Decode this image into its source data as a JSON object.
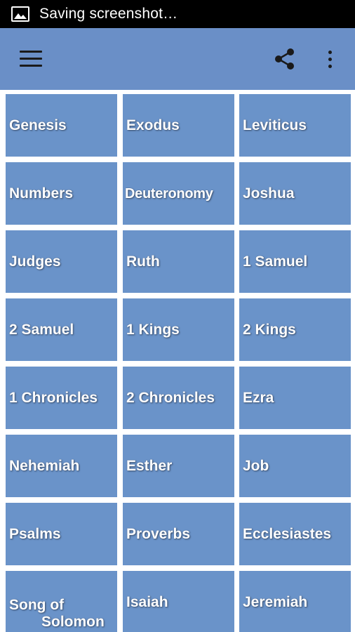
{
  "status_bar": {
    "notification_icon": "image-icon",
    "text": "Saving screenshot…"
  },
  "app_bar": {
    "menu_icon": "hamburger-menu-icon",
    "share_icon": "share-icon",
    "overflow_icon": "more-vert-icon",
    "color": "#6a8fc7"
  },
  "tile_color": "#6a93c9",
  "books": [
    "Genesis",
    "Exodus",
    "Leviticus",
    "Numbers",
    "Deuteronomy",
    "Joshua",
    "Judges",
    "Ruth",
    "1 Samuel",
    "2 Samuel",
    "1 Kings",
    "2 Kings",
    "1 Chronicles",
    "2 Chronicles",
    "Ezra",
    "Nehemiah",
    "Esther",
    "Job",
    "Psalms",
    "Proverbs",
    "Ecclesiastes",
    "Song of Solomon",
    "Isaiah",
    "Jeremiah"
  ]
}
